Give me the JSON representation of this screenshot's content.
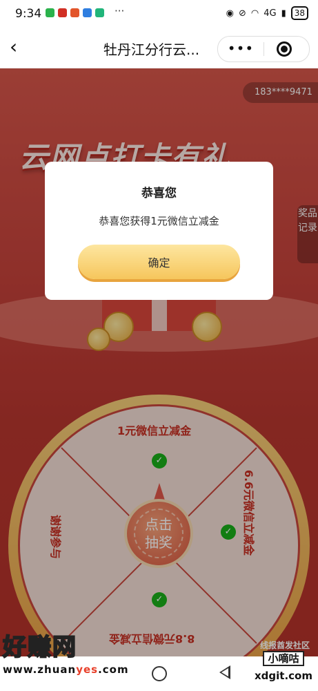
{
  "status_bar": {
    "time": "9:34",
    "dots": "···",
    "network": "4G",
    "battery": "38"
  },
  "nav": {
    "back": "‹",
    "title": "牡丹江分行云...",
    "more": "•••"
  },
  "page": {
    "phone": "183****9471",
    "banner": "云网点打卡有礼",
    "record_button": "奖品记录",
    "forum_watermark": "线报酋发社区"
  },
  "wheel": {
    "prizes": [
      "1元微信立减金",
      "6.6元微信立减金",
      "8.8元微信立减金",
      "谢谢参与"
    ],
    "spin_line1": "点击",
    "spin_line2": "抽奖"
  },
  "modal": {
    "title": "恭喜您",
    "message": "恭喜您获得1元微信立减金",
    "confirm": "确定"
  },
  "watermarks": {
    "left_big": "好赚网",
    "left_url_a": "www.zhuan",
    "left_url_b": "yes",
    "left_url_c": ".com",
    "right_tag": "小嘀咕",
    "right_domain": "xdgit.com"
  }
}
